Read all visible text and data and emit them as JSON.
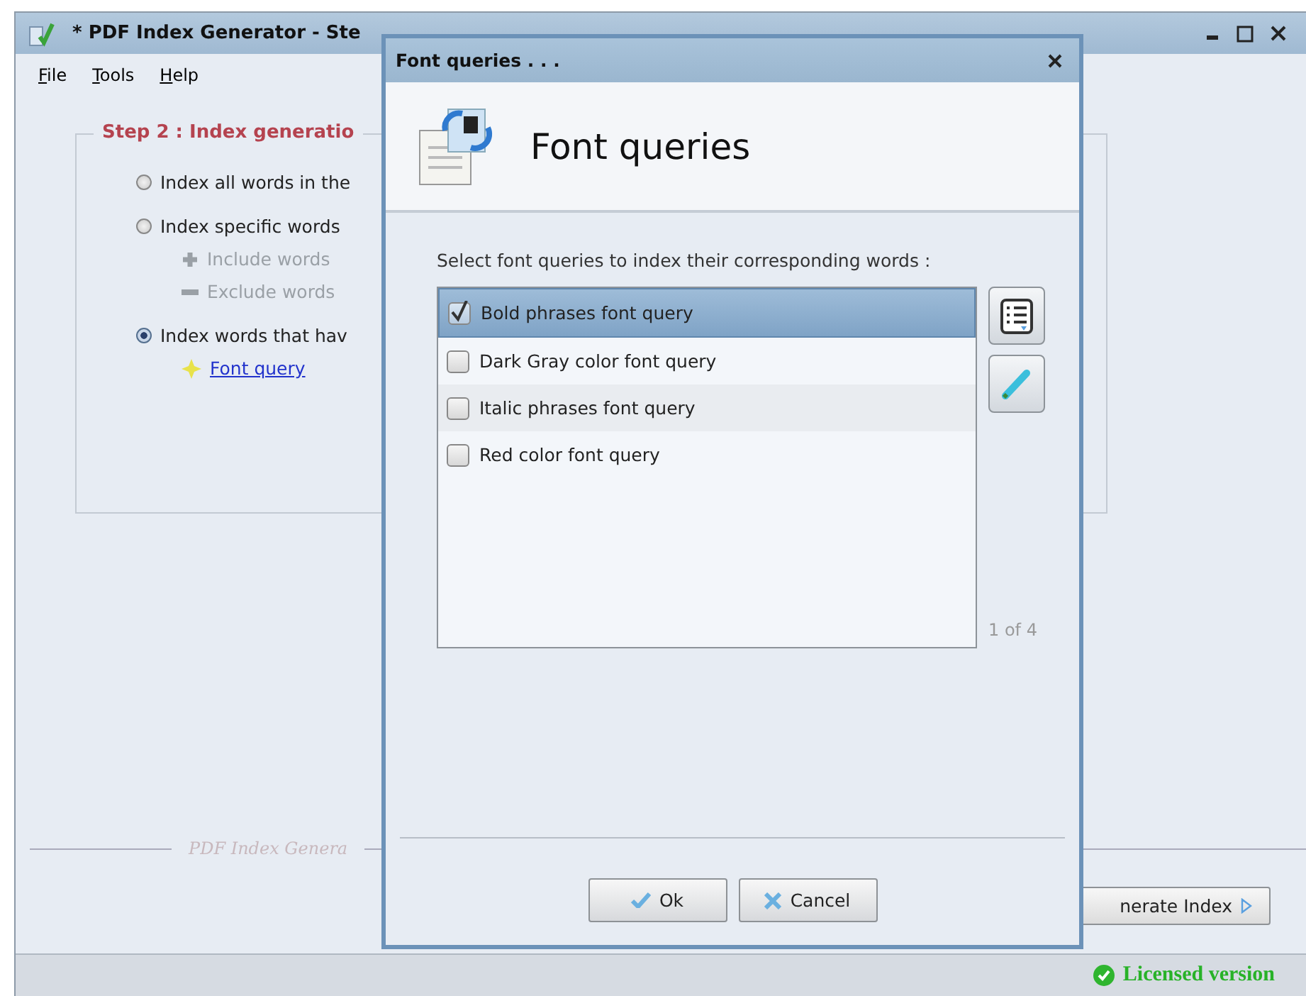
{
  "main_window": {
    "title": "* PDF Index Generator - Ste",
    "menu": [
      {
        "label": "File"
      },
      {
        "label": "Tools"
      },
      {
        "label": "Help"
      }
    ],
    "step_group": {
      "title": "Step 2 : Index generatio",
      "options": [
        {
          "label": "Index all words in the",
          "selected": false
        },
        {
          "label": "Index specific words",
          "selected": false,
          "children": [
            {
              "kind": "include",
              "label": "Include words",
              "disabled": true
            },
            {
              "kind": "exclude",
              "label": "Exclude words",
              "disabled": true
            }
          ]
        },
        {
          "label": "Index words that hav",
          "selected": true,
          "children": [
            {
              "kind": "query",
              "label": "Font query",
              "disabled": false
            }
          ]
        }
      ]
    },
    "footer_text": "PDF Index Genera",
    "generate_button": "nerate Index",
    "status": "Licensed version"
  },
  "dialog": {
    "title": "Font queries . . .",
    "heading": "Font queries",
    "instruction": "Select font queries to index their corresponding words :",
    "queries": [
      {
        "label": "Bold phrases font query",
        "checked": true,
        "selected": true
      },
      {
        "label": "Dark Gray color font query",
        "checked": false,
        "selected": false
      },
      {
        "label": "Italic phrases font query",
        "checked": false,
        "selected": false
      },
      {
        "label": "Red color font query",
        "checked": false,
        "selected": false
      }
    ],
    "counter": "1 of 4",
    "buttons": [
      {
        "kind": "ok",
        "label": "Ok"
      },
      {
        "kind": "cancel",
        "label": "Cancel"
      }
    ]
  }
}
